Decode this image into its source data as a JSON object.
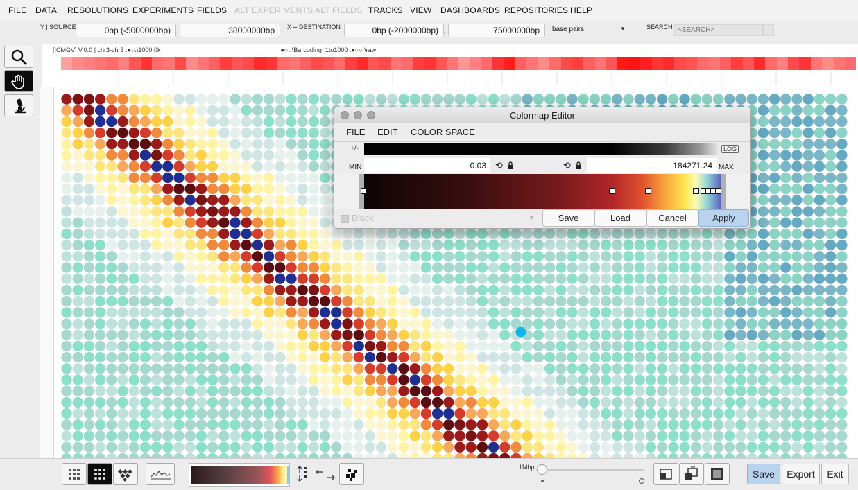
{
  "menu": [
    {
      "label": "FILE",
      "enabled": true
    },
    {
      "label": "DATA",
      "enabled": true
    },
    {
      "label": "RESOLUTIONS",
      "enabled": true
    },
    {
      "label": "EXPERIMENTS",
      "enabled": true
    },
    {
      "label": "FIELDS",
      "enabled": true
    },
    {
      "label": "ALT EXPERIMENTS",
      "enabled": false
    },
    {
      "label": "ALT FIELDS",
      "enabled": false
    },
    {
      "label": "TRACKS",
      "enabled": true
    },
    {
      "label": "VIEW",
      "enabled": true
    },
    {
      "label": "DASHBOARDS",
      "enabled": true
    },
    {
      "label": "REPOSITORIES",
      "enabled": true
    },
    {
      "label": "HELP",
      "enabled": true
    }
  ],
  "coords": {
    "source_label": "Y | SOURCE",
    "source_start": "0bp (-5000000bp)",
    "source_end": "38000000bp",
    "dest_label": "X -- DESTINATION",
    "dest_start": "0bp (-2000000bp)",
    "dest_end": "75000000bp",
    "separator": "..",
    "units": "base pairs",
    "search_label": "SEARCH",
    "search_placeholder": "<SEARCH>"
  },
  "tools": [
    "magnifier-icon",
    "hand-pan-icon",
    "microscope-icon"
  ],
  "track_header": {
    "left": "[ICMGV] V.0.0 | chr3-chr3  :●○.\\1000.0k",
    "right": ":●○○\\Barcoding_1to1000  :●○○ \\raw"
  },
  "heat_strip": [
    0.35,
    0.45,
    0.5,
    0.55,
    0.6,
    0.5,
    0.7,
    0.85,
    0.6,
    0.55,
    0.75,
    0.45,
    0.55,
    0.65,
    0.8,
    0.7,
    0.75,
    0.9,
    0.85,
    0.6,
    0.55,
    0.65,
    0.75,
    0.7,
    0.6,
    0.8,
    0.9,
    0.7,
    0.75,
    0.55,
    0.6,
    0.8,
    0.85,
    0.7,
    0.55,
    0.4,
    0.5,
    0.6,
    0.85,
    0.95,
    0.65,
    0.55,
    0.45,
    0.6,
    0.75,
    0.8,
    0.65,
    0.55,
    0.7,
    0.98,
    1.0,
    0.95,
    0.85,
    0.9,
    0.75,
    0.7,
    0.6,
    0.55,
    0.65,
    0.8,
    0.7,
    0.9,
    0.6,
    0.5,
    0.75,
    0.85,
    0.55,
    0.45,
    0.55,
    0.6
  ],
  "colormap_editor": {
    "title": "Colormap Editor",
    "menus": [
      "FILE",
      "EDIT",
      "COLOR SPACE"
    ],
    "plusminus": "+/-",
    "log_label": "LOG",
    "min_label": "MIN",
    "max_label": "MAX",
    "min_value": "0.03",
    "max_value": "184271.24",
    "color_select": "Black",
    "buttons": {
      "save": "Save",
      "load": "Load",
      "cancel": "Cancel",
      "apply": "Apply"
    }
  },
  "bottom": {
    "zoom_label": "1Mbp",
    "zoom_value": 0.0,
    "save": "Save",
    "export": "Export",
    "exit": "Exit"
  }
}
